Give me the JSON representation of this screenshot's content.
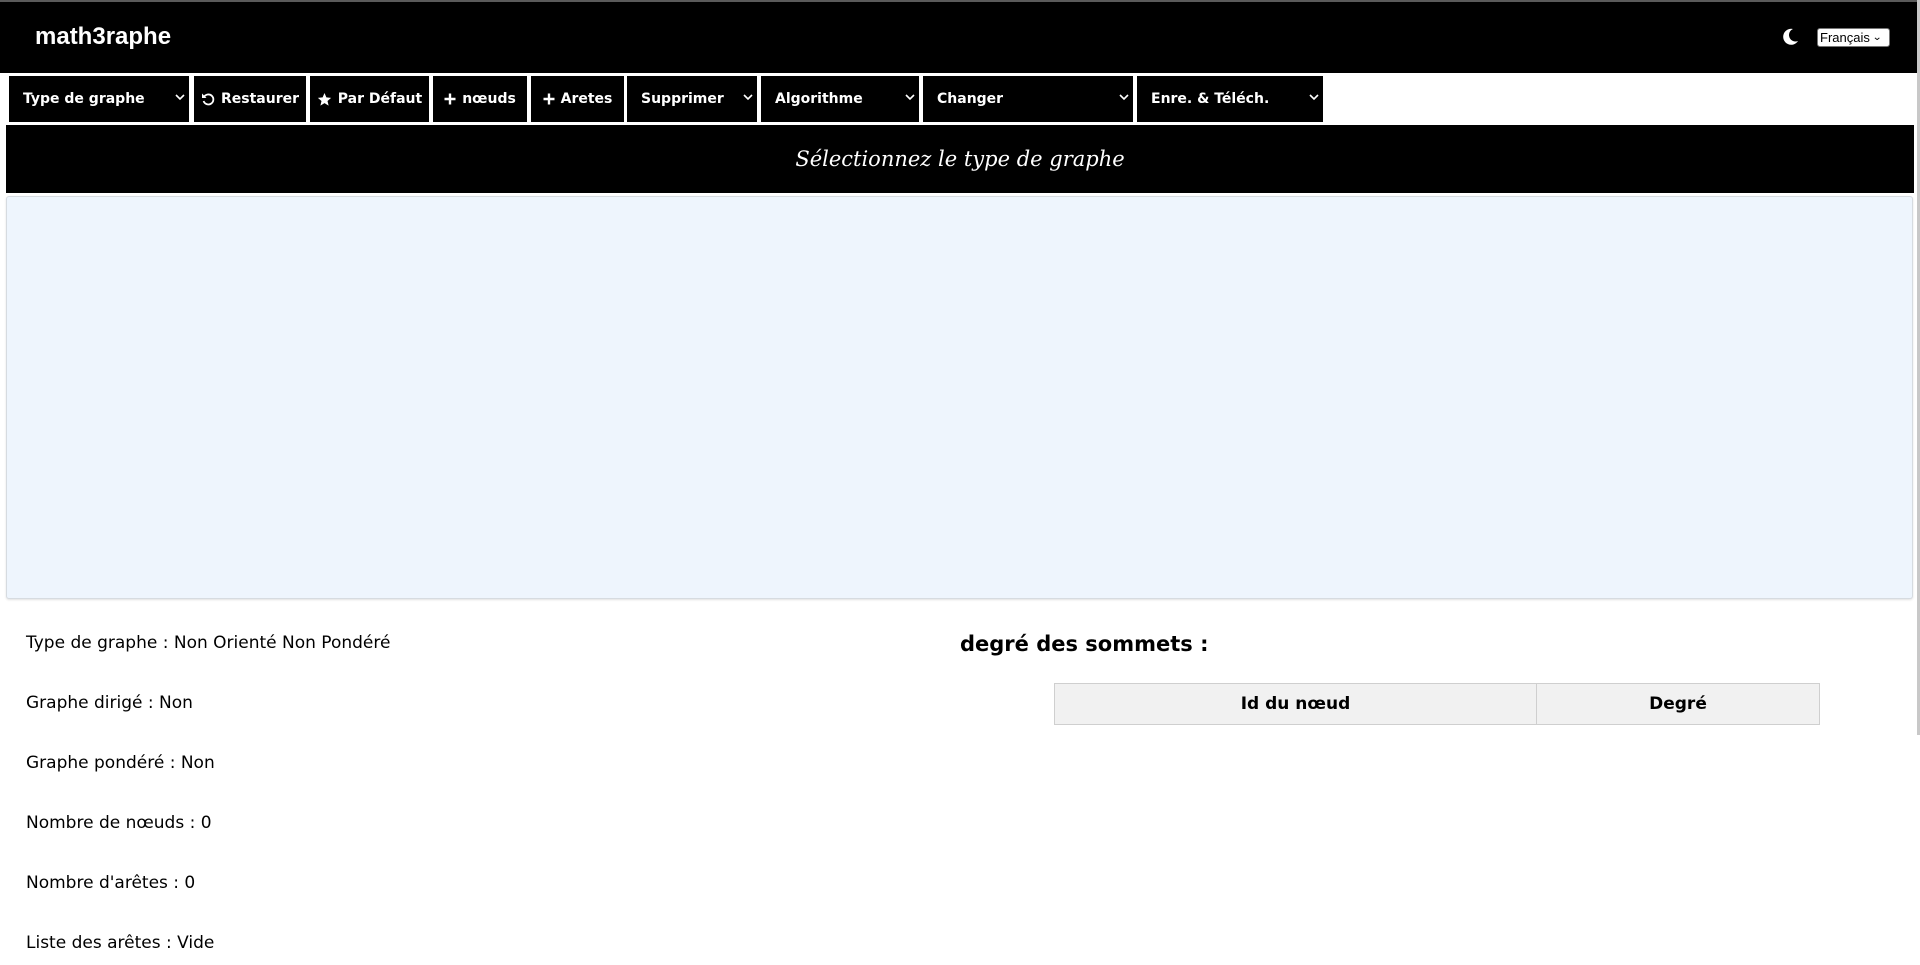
{
  "header": {
    "brand": "math3raphe",
    "theme_toggle_icon": "moon-icon",
    "language": "Français"
  },
  "toolbar": {
    "graph_type": "Type de graphe",
    "restore": "Restaurer",
    "default": "Par Défaut",
    "add_nodes": "nœuds",
    "add_edges": "Aretes",
    "delete": "Supprimer",
    "algorithm": "Algorithme",
    "change": "Changer",
    "save_download": "Enre. & Téléch."
  },
  "banner": {
    "text": "Sélectionnez le type de graphe"
  },
  "info": {
    "graph_type": "Type de graphe : Non Orienté Non Pondéré",
    "directed": "Graphe dirigé : Non",
    "weighted": "Graphe pondéré : Non",
    "node_count": "Nombre de nœuds : 0",
    "edge_count": "Nombre d'arêtes : 0",
    "edge_list": "Liste des arêtes : Vide"
  },
  "degree": {
    "title": "degré des sommets :",
    "columns": [
      "Id du nœud",
      "Degré"
    ]
  },
  "colors": {
    "bar": "#000000",
    "canvas": "#eef5fd",
    "table_header": "#f1f1f1"
  }
}
